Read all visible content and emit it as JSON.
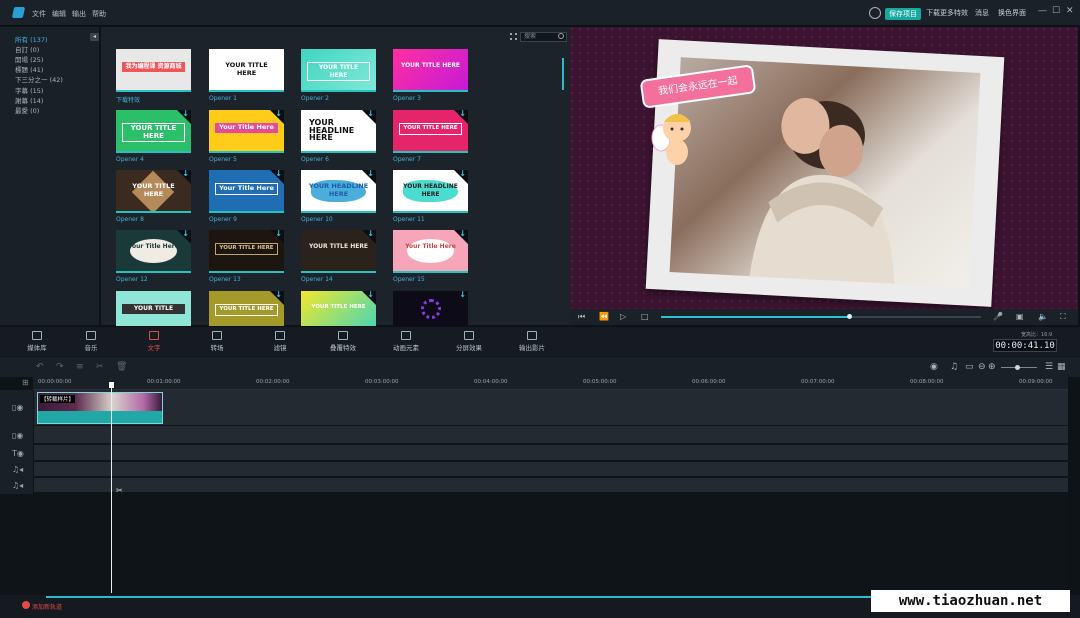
{
  "menu": [
    "文件",
    "编辑",
    "输出",
    "帮助"
  ],
  "titlebar": {
    "save_label": "保存项目",
    "download_label": "下载更多特效",
    "message_label": "消息",
    "skin_label": "换色界面"
  },
  "categories": [
    "所有 (137)",
    "自訂 (0)",
    "開場 (25)",
    "標題 (41)",
    "下三分之一 (42)",
    "字幕 (15)",
    "謝幕 (14)",
    "最愛 (0)"
  ],
  "search": {
    "placeholder": "搜索"
  },
  "templates": [
    {
      "label": "下载特效",
      "text": "我为编程课 资源商城",
      "style": "t0"
    },
    {
      "label": "Opener 1",
      "text": "YOUR TITLE HERE",
      "style": "t1"
    },
    {
      "label": "Opener 2",
      "text": "YOUR TITLE HERE",
      "style": "t2"
    },
    {
      "label": "Opener 3",
      "text": "YOUR TITLE HERE",
      "style": "t3"
    },
    {
      "label": "Opener 4",
      "text": "YOUR TITLE HERE",
      "style": "t4"
    },
    {
      "label": "Opener 5",
      "text": "Your Title Here",
      "style": "t5"
    },
    {
      "label": "Opener 6",
      "text": "YOUR HEADLINE HERE",
      "style": "t6"
    },
    {
      "label": "Opener 7",
      "text": "YOUR TITLE HERE",
      "style": "t7"
    },
    {
      "label": "Opener 8",
      "text": "YOUR TITLE HERE",
      "style": "t8"
    },
    {
      "label": "Opener 9",
      "text": "Your Title Here",
      "style": "t9"
    },
    {
      "label": "Opener 10",
      "text": "YOUR HEADLINE HERE",
      "style": "t10"
    },
    {
      "label": "Opener 11",
      "text": "YOUR HEADLINE HERE",
      "style": "t11"
    },
    {
      "label": "Opener 12",
      "text": "Your Title Here",
      "style": "t12"
    },
    {
      "label": "Opener 13",
      "text": "YOUR TITLE HERE",
      "style": "t13"
    },
    {
      "label": "Opener 14",
      "text": "YOUR TITLE HERE",
      "style": "t14"
    },
    {
      "label": "Opener 15",
      "text": "Your Title Here",
      "style": "t15"
    },
    {
      "label": "",
      "text": "YOUR TITLE",
      "style": "t16"
    },
    {
      "label": "",
      "text": "YOUR TITLE HERE",
      "style": "t17"
    },
    {
      "label": "",
      "text": "YOUR TITLE HERE",
      "style": "t18"
    },
    {
      "label": "",
      "text": "",
      "style": "t19"
    }
  ],
  "preview": {
    "caption": "我们会永远在一起"
  },
  "toolbar": [
    {
      "label": "媒体库",
      "name": "media"
    },
    {
      "label": "音乐",
      "name": "music"
    },
    {
      "label": "文字",
      "name": "text"
    },
    {
      "label": "转场",
      "name": "transition"
    },
    {
      "label": "滤镜",
      "name": "filter"
    },
    {
      "label": "叠覆特效",
      "name": "overlay"
    },
    {
      "label": "动画元素",
      "name": "elements"
    },
    {
      "label": "分屏效果",
      "name": "split-screen"
    },
    {
      "label": "输出影片",
      "name": "export"
    }
  ],
  "timecode": {
    "label": "宽高比：16:9",
    "value": "00:00:41.10"
  },
  "ruler": [
    "00:00:00:00",
    "00:01:00:00",
    "00:02:00:00",
    "00:03:00:00",
    "00:04:00:00",
    "00:05:00:00",
    "00:06:00:00",
    "00:07:00:00",
    "00:08:00:00",
    "00:09:00:00"
  ],
  "clip": {
    "label": "【转载样片】"
  },
  "bottom": {
    "add_track": "添加新轨道"
  },
  "watermark": "www.tiaozhuan.net",
  "colors": {
    "accent": "#22a7a7",
    "active": "#e14c4c",
    "link": "#3fb6d8"
  }
}
